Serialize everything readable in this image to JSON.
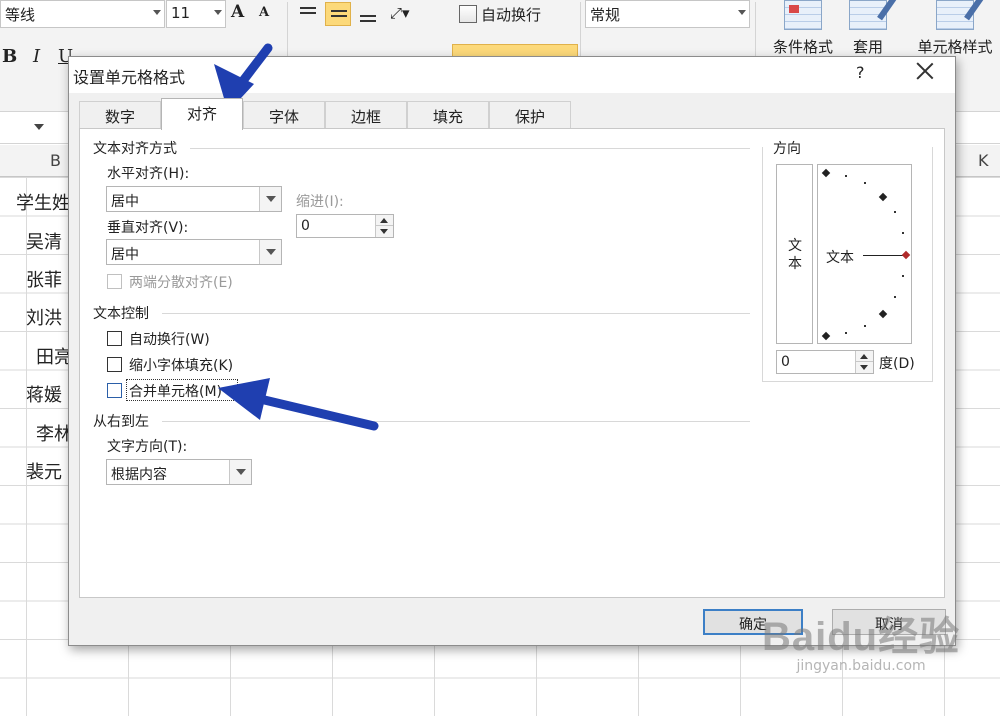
{
  "ribbon": {
    "font_name": "等线",
    "font_size": "11",
    "grow_font": "A",
    "shrink_font": "A",
    "bold": "B",
    "italic": "I",
    "underline": "U",
    "wrap_text": "自动换行",
    "number_format": "常规",
    "conditional_format": "条件格式",
    "format_as_table": "套用",
    "cell_styles": "单元格样式"
  },
  "sheet": {
    "col_b": "B",
    "col_k": "K",
    "cells": [
      "学生姓",
      "吴清",
      "张菲",
      "刘洪",
      "田亮",
      "蒋媛",
      "李林",
      "裴元"
    ]
  },
  "dialog": {
    "title": "设置单元格格式",
    "help": "?",
    "tabs": [
      "数字",
      "对齐",
      "字体",
      "边框",
      "填充",
      "保护"
    ],
    "active_tab": "对齐",
    "text_alignment": {
      "group_title": "文本对齐方式",
      "horizontal_label": "水平对齐(H):",
      "horizontal_value": "居中",
      "vertical_label": "垂直对齐(V):",
      "vertical_value": "居中",
      "indent_label": "缩进(I):",
      "indent_value": "0",
      "justify_distributed": "两端分散对齐(E)"
    },
    "text_control": {
      "group_title": "文本控制",
      "wrap_text": "自动换行(W)",
      "shrink_to_fit": "缩小字体填充(K)",
      "merge_cells": "合并单元格(M)"
    },
    "rtl": {
      "group_title": "从右到左",
      "direction_label": "文字方向(T):",
      "direction_value": "根据内容"
    },
    "orientation": {
      "group_title": "方向",
      "vertical_text": "文本",
      "horizontal_text": "文本",
      "degrees_value": "0",
      "degrees_label": "度(D)"
    },
    "ok": "确定",
    "cancel": "取消"
  },
  "watermark": {
    "logo": "Baidu经验",
    "url": "jingyan.baidu.com"
  },
  "colors": {
    "annotation_arrow": "#1f3fb0",
    "selected_button": "#fcd97a"
  }
}
